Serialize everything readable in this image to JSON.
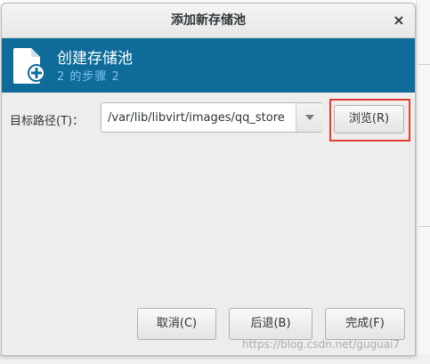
{
  "dialog": {
    "title": "添加新存储池",
    "close_glyph": "×"
  },
  "header": {
    "title": "创建存储池",
    "step": "2 的步骤 2",
    "icon": "new-document-plus-icon"
  },
  "form": {
    "target_path_label": "目标路径(T)：",
    "target_path_value": "/var/lib/libvirt/images/qq_store",
    "browse_label": "浏览(R)"
  },
  "buttons": {
    "cancel_label": "取消(C)",
    "back_label": "后退(B)",
    "finish_label": "完成(F)"
  },
  "watermark": "https://blog.csdn.net/guguai7",
  "colors": {
    "header_bg": "#0f6c9a",
    "highlight": "#e53935"
  }
}
